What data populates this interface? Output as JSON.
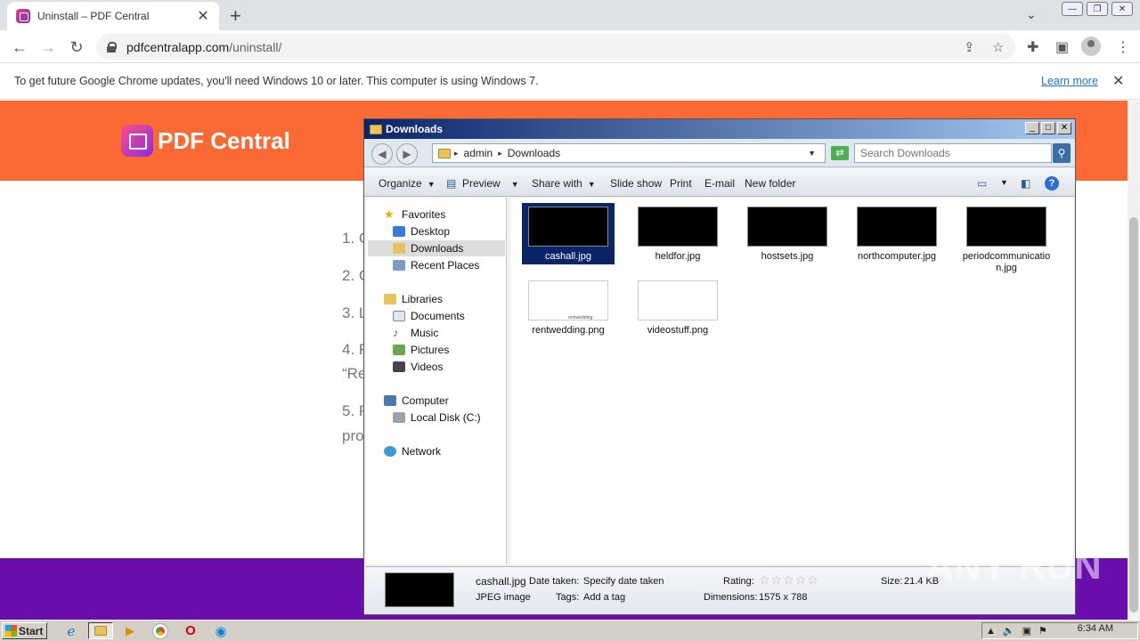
{
  "browser": {
    "tab": {
      "title": "Uninstall – PDF Central"
    },
    "address": {
      "host": "pdfcentralapp.com",
      "path": "/uninstall/"
    },
    "infobar": {
      "message": "To get future Google Chrome updates, you'll need Windows 10 or later. This computer is using Windows 7.",
      "link": "Learn more"
    }
  },
  "page": {
    "brand": "PDF Central",
    "steps": [
      "1. C",
      "2. C",
      "3. L",
      "4. F",
      "“Re",
      "5. F",
      "pro"
    ]
  },
  "explorer": {
    "title": "Downloads",
    "breadcrumb": [
      "admin",
      "Downloads"
    ],
    "search_placeholder": "Search Downloads",
    "commands": [
      "Organize",
      "Preview",
      "Share with",
      "Slide show",
      "Print",
      "E-mail",
      "New folder"
    ],
    "nav": {
      "favorites_header": "Favorites",
      "favorites": [
        "Desktop",
        "Downloads",
        "Recent Places"
      ],
      "libraries_header": "Libraries",
      "libraries": [
        "Documents",
        "Music",
        "Pictures",
        "Videos"
      ],
      "computer_header": "Computer",
      "drives": [
        "Local Disk (C:)"
      ],
      "network": "Network"
    },
    "files": [
      {
        "name": "cashall.jpg",
        "thumb": "black"
      },
      {
        "name": "heldfor.jpg",
        "thumb": "black"
      },
      {
        "name": "hostsets.jpg",
        "thumb": "black"
      },
      {
        "name": "northcomputer.jpg",
        "thumb": "black"
      },
      {
        "name": "periodcommunication.jpg",
        "thumb": "black"
      },
      {
        "name": "rentwedding.png",
        "thumb": "white"
      },
      {
        "name": "videostuff.png",
        "thumb": "white"
      }
    ],
    "details": {
      "file_name": "cashall.jpg",
      "file_type": "JPEG image",
      "date_taken_label": "Date taken:",
      "date_taken_value": "Specify date taken",
      "tags_label": "Tags:",
      "tags_value": "Add a tag",
      "rating_label": "Rating:",
      "dimensions_label": "Dimensions:",
      "dimensions_value": "1575 x 788",
      "size_label": "Size:",
      "size_value": "21.4 KB"
    }
  },
  "taskbar": {
    "start": "Start",
    "clock": "6:34 AM"
  },
  "watermark": "ANY RUN",
  "thumb_label": "rentwedding"
}
